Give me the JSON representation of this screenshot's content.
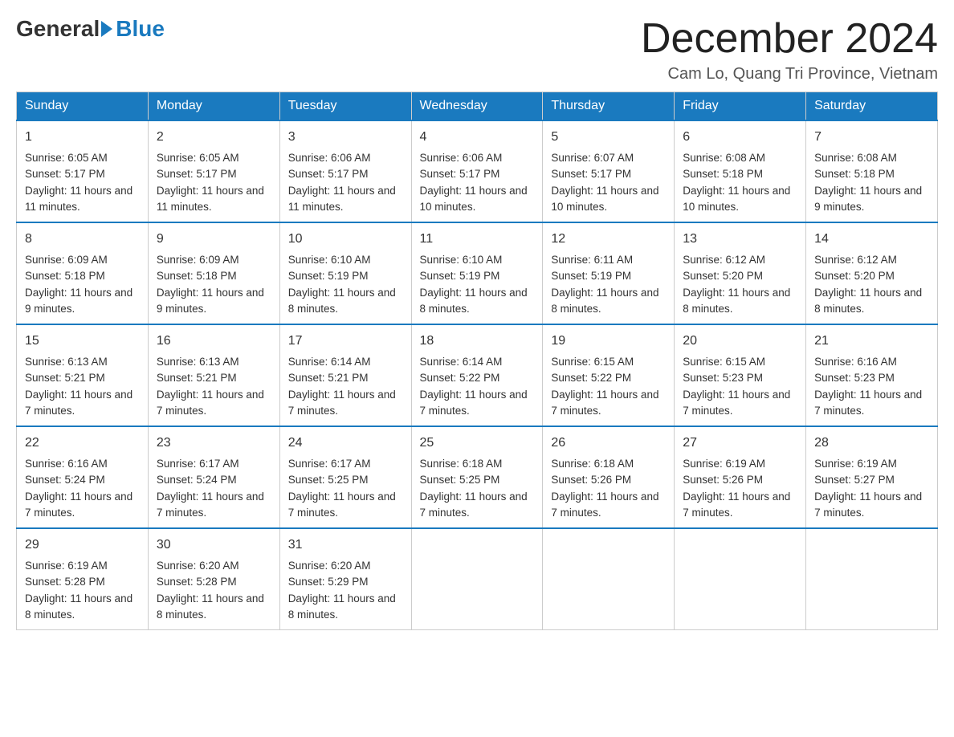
{
  "logo": {
    "general": "General",
    "blue": "Blue",
    "arrow": "▶"
  },
  "title": "December 2024",
  "subtitle": "Cam Lo, Quang Tri Province, Vietnam",
  "days_of_week": [
    "Sunday",
    "Monday",
    "Tuesday",
    "Wednesday",
    "Thursday",
    "Friday",
    "Saturday"
  ],
  "weeks": [
    [
      {
        "day": "1",
        "sunrise": "6:05 AM",
        "sunset": "5:17 PM",
        "daylight": "11 hours and 11 minutes."
      },
      {
        "day": "2",
        "sunrise": "6:05 AM",
        "sunset": "5:17 PM",
        "daylight": "11 hours and 11 minutes."
      },
      {
        "day": "3",
        "sunrise": "6:06 AM",
        "sunset": "5:17 PM",
        "daylight": "11 hours and 11 minutes."
      },
      {
        "day": "4",
        "sunrise": "6:06 AM",
        "sunset": "5:17 PM",
        "daylight": "11 hours and 10 minutes."
      },
      {
        "day": "5",
        "sunrise": "6:07 AM",
        "sunset": "5:17 PM",
        "daylight": "11 hours and 10 minutes."
      },
      {
        "day": "6",
        "sunrise": "6:08 AM",
        "sunset": "5:18 PM",
        "daylight": "11 hours and 10 minutes."
      },
      {
        "day": "7",
        "sunrise": "6:08 AM",
        "sunset": "5:18 PM",
        "daylight": "11 hours and 9 minutes."
      }
    ],
    [
      {
        "day": "8",
        "sunrise": "6:09 AM",
        "sunset": "5:18 PM",
        "daylight": "11 hours and 9 minutes."
      },
      {
        "day": "9",
        "sunrise": "6:09 AM",
        "sunset": "5:18 PM",
        "daylight": "11 hours and 9 minutes."
      },
      {
        "day": "10",
        "sunrise": "6:10 AM",
        "sunset": "5:19 PM",
        "daylight": "11 hours and 8 minutes."
      },
      {
        "day": "11",
        "sunrise": "6:10 AM",
        "sunset": "5:19 PM",
        "daylight": "11 hours and 8 minutes."
      },
      {
        "day": "12",
        "sunrise": "6:11 AM",
        "sunset": "5:19 PM",
        "daylight": "11 hours and 8 minutes."
      },
      {
        "day": "13",
        "sunrise": "6:12 AM",
        "sunset": "5:20 PM",
        "daylight": "11 hours and 8 minutes."
      },
      {
        "day": "14",
        "sunrise": "6:12 AM",
        "sunset": "5:20 PM",
        "daylight": "11 hours and 8 minutes."
      }
    ],
    [
      {
        "day": "15",
        "sunrise": "6:13 AM",
        "sunset": "5:21 PM",
        "daylight": "11 hours and 7 minutes."
      },
      {
        "day": "16",
        "sunrise": "6:13 AM",
        "sunset": "5:21 PM",
        "daylight": "11 hours and 7 minutes."
      },
      {
        "day": "17",
        "sunrise": "6:14 AM",
        "sunset": "5:21 PM",
        "daylight": "11 hours and 7 minutes."
      },
      {
        "day": "18",
        "sunrise": "6:14 AM",
        "sunset": "5:22 PM",
        "daylight": "11 hours and 7 minutes."
      },
      {
        "day": "19",
        "sunrise": "6:15 AM",
        "sunset": "5:22 PM",
        "daylight": "11 hours and 7 minutes."
      },
      {
        "day": "20",
        "sunrise": "6:15 AM",
        "sunset": "5:23 PM",
        "daylight": "11 hours and 7 minutes."
      },
      {
        "day": "21",
        "sunrise": "6:16 AM",
        "sunset": "5:23 PM",
        "daylight": "11 hours and 7 minutes."
      }
    ],
    [
      {
        "day": "22",
        "sunrise": "6:16 AM",
        "sunset": "5:24 PM",
        "daylight": "11 hours and 7 minutes."
      },
      {
        "day": "23",
        "sunrise": "6:17 AM",
        "sunset": "5:24 PM",
        "daylight": "11 hours and 7 minutes."
      },
      {
        "day": "24",
        "sunrise": "6:17 AM",
        "sunset": "5:25 PM",
        "daylight": "11 hours and 7 minutes."
      },
      {
        "day": "25",
        "sunrise": "6:18 AM",
        "sunset": "5:25 PM",
        "daylight": "11 hours and 7 minutes."
      },
      {
        "day": "26",
        "sunrise": "6:18 AM",
        "sunset": "5:26 PM",
        "daylight": "11 hours and 7 minutes."
      },
      {
        "day": "27",
        "sunrise": "6:19 AM",
        "sunset": "5:26 PM",
        "daylight": "11 hours and 7 minutes."
      },
      {
        "day": "28",
        "sunrise": "6:19 AM",
        "sunset": "5:27 PM",
        "daylight": "11 hours and 7 minutes."
      }
    ],
    [
      {
        "day": "29",
        "sunrise": "6:19 AM",
        "sunset": "5:28 PM",
        "daylight": "11 hours and 8 minutes."
      },
      {
        "day": "30",
        "sunrise": "6:20 AM",
        "sunset": "5:28 PM",
        "daylight": "11 hours and 8 minutes."
      },
      {
        "day": "31",
        "sunrise": "6:20 AM",
        "sunset": "5:29 PM",
        "daylight": "11 hours and 8 minutes."
      },
      null,
      null,
      null,
      null
    ]
  ]
}
